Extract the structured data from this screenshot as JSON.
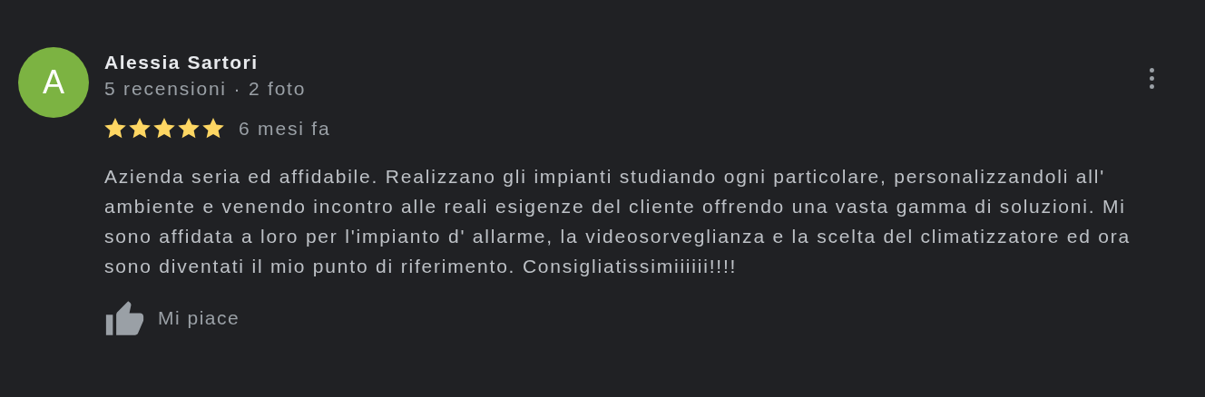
{
  "review": {
    "avatar_letter": "A",
    "author": "Alessia Sartori",
    "meta": "5 recensioni · 2 foto",
    "stars": 5,
    "time": "6 mesi fa",
    "text": "Azienda seria ed affidabile. Realizzano gli impianti studiando ogni particolare, personalizzandoli all' ambiente e venendo incontro alle reali esigenze del cliente offrendo una vasta gamma di soluzioni. Mi sono affidata a loro per l'impianto d' allarme, la videosorveglianza e la scelta del climatizzatore ed ora sono diventati il mio punto di riferimento. Consigliatissimiiiiii!!!!",
    "like_label": "Mi piace"
  }
}
